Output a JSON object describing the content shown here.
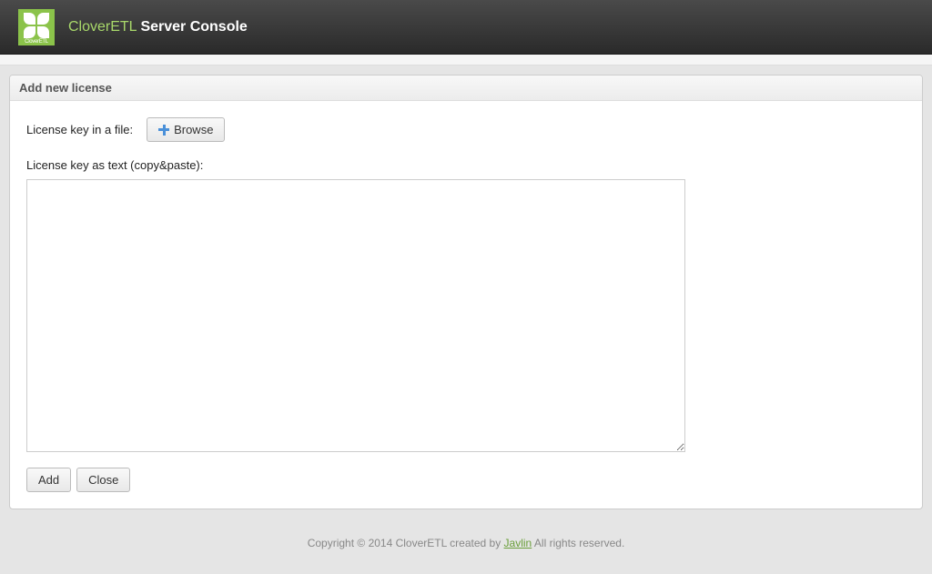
{
  "header": {
    "brand": "CloverETL",
    "title_rest": "Server Console",
    "logo_text": "CloverETL"
  },
  "panel": {
    "title": "Add new license"
  },
  "form": {
    "file_label": "License key in a file:",
    "browse_button": "Browse",
    "text_label": "License key as text (copy&paste):",
    "textarea_value": "",
    "add_button": "Add",
    "close_button": "Close"
  },
  "footer": {
    "prefix": "Copyright © 2014 CloverETL created by ",
    "link_text": "Javlin",
    "suffix": " All rights reserved."
  }
}
